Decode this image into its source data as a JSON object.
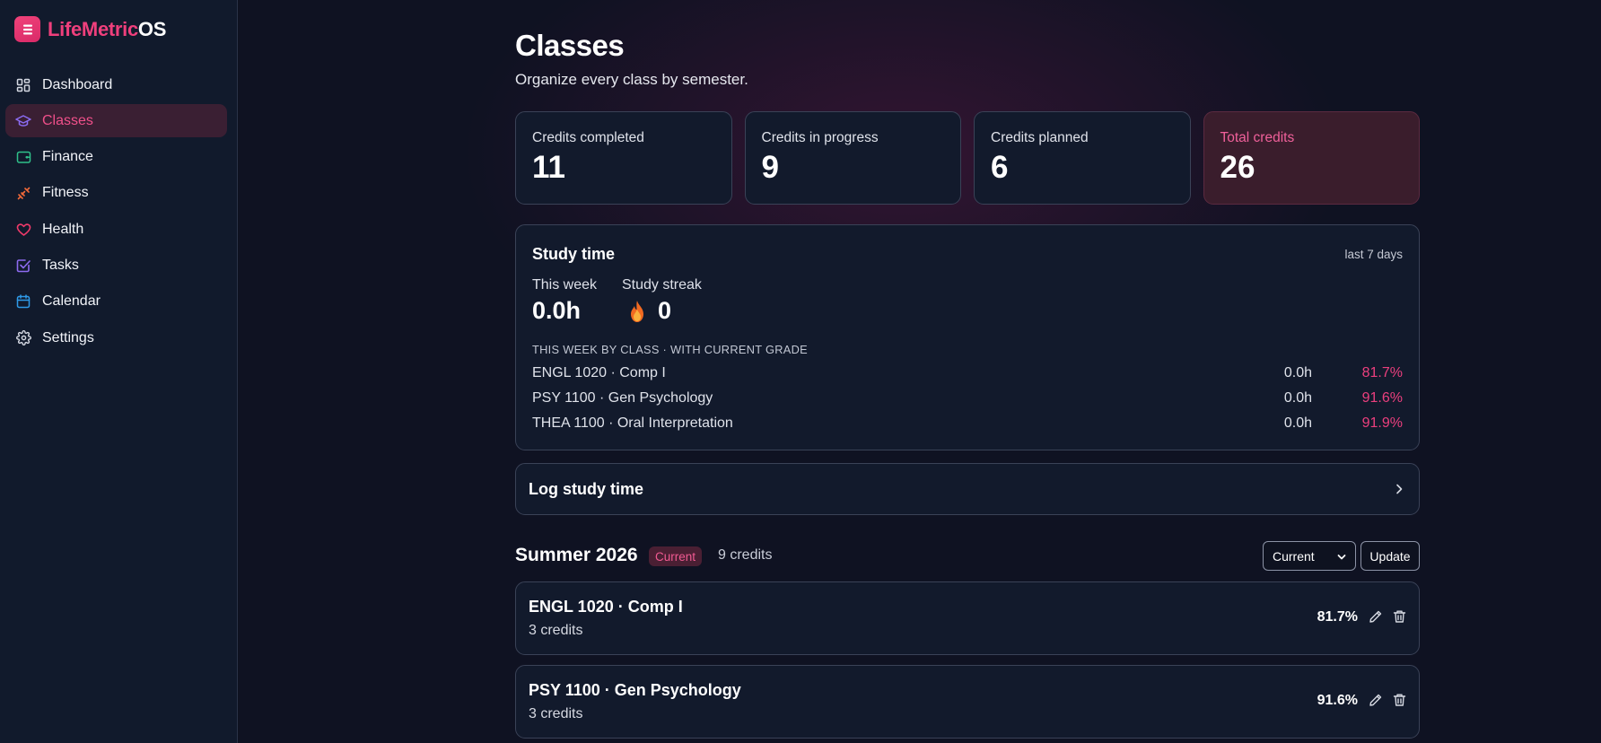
{
  "brand": {
    "name_part1": "LifeMetric",
    "name_part2": "OS"
  },
  "sidebar": {
    "items": [
      {
        "label": "Dashboard",
        "icon": "grid-icon"
      },
      {
        "label": "Classes",
        "icon": "graduation-cap-icon",
        "active": true
      },
      {
        "label": "Finance",
        "icon": "wallet-icon"
      },
      {
        "label": "Fitness",
        "icon": "dumbbell-icon"
      },
      {
        "label": "Health",
        "icon": "heart-icon"
      },
      {
        "label": "Tasks",
        "icon": "check-square-icon"
      },
      {
        "label": "Calendar",
        "icon": "calendar-icon"
      },
      {
        "label": "Settings",
        "icon": "gear-icon"
      }
    ]
  },
  "page": {
    "title": "Classes",
    "subtitle": "Organize every class by semester."
  },
  "stats": [
    {
      "label": "Credits completed",
      "value": "11"
    },
    {
      "label": "Credits in progress",
      "value": "9"
    },
    {
      "label": "Credits planned",
      "value": "6"
    },
    {
      "label": "Total credits",
      "value": "26"
    }
  ],
  "study": {
    "title": "Study time",
    "range": "last 7 days",
    "this_week_label": "This week",
    "this_week_value": "0.0h",
    "streak_label": "Study streak",
    "streak_value": "0",
    "section_caption": "THIS WEEK BY CLASS · WITH CURRENT GRADE",
    "classes": [
      {
        "name": "ENGL 1020 · Comp I",
        "hours": "0.0h",
        "grade": "81.7%"
      },
      {
        "name": "PSY 1100 · Gen Psychology",
        "hours": "0.0h",
        "grade": "91.6%"
      },
      {
        "name": "THEA 1100 · Oral Interpretation",
        "hours": "0.0h",
        "grade": "91.9%"
      }
    ]
  },
  "log": {
    "label": "Log study time"
  },
  "semester": {
    "title": "Summer 2026",
    "badge": "Current",
    "credits": "9 credits",
    "select_value": "Current",
    "update_label": "Update",
    "courses": [
      {
        "name": "ENGL 1020 · Comp I",
        "credits": "3 credits",
        "grade": "81.7%"
      },
      {
        "name": "PSY 1100 · Gen Psychology",
        "credits": "3 credits",
        "grade": "91.6%"
      }
    ]
  },
  "colors": {
    "accent": "#ef3f7c",
    "background": "#0f1222",
    "sidebar": "#111a2c",
    "card": "#121a2c",
    "highlight_card": "#3a1d2c"
  }
}
